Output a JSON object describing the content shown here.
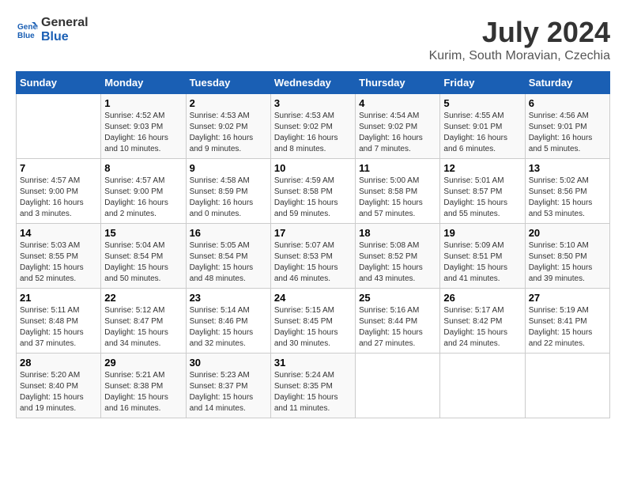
{
  "header": {
    "logo_line1": "General",
    "logo_line2": "Blue",
    "month": "July 2024",
    "location": "Kurim, South Moravian, Czechia"
  },
  "weekdays": [
    "Sunday",
    "Monday",
    "Tuesday",
    "Wednesday",
    "Thursday",
    "Friday",
    "Saturday"
  ],
  "weeks": [
    [
      {
        "day": "",
        "info": ""
      },
      {
        "day": "1",
        "info": "Sunrise: 4:52 AM\nSunset: 9:03 PM\nDaylight: 16 hours\nand 10 minutes."
      },
      {
        "day": "2",
        "info": "Sunrise: 4:53 AM\nSunset: 9:02 PM\nDaylight: 16 hours\nand 9 minutes."
      },
      {
        "day": "3",
        "info": "Sunrise: 4:53 AM\nSunset: 9:02 PM\nDaylight: 16 hours\nand 8 minutes."
      },
      {
        "day": "4",
        "info": "Sunrise: 4:54 AM\nSunset: 9:02 PM\nDaylight: 16 hours\nand 7 minutes."
      },
      {
        "day": "5",
        "info": "Sunrise: 4:55 AM\nSunset: 9:01 PM\nDaylight: 16 hours\nand 6 minutes."
      },
      {
        "day": "6",
        "info": "Sunrise: 4:56 AM\nSunset: 9:01 PM\nDaylight: 16 hours\nand 5 minutes."
      }
    ],
    [
      {
        "day": "7",
        "info": "Sunrise: 4:57 AM\nSunset: 9:00 PM\nDaylight: 16 hours\nand 3 minutes."
      },
      {
        "day": "8",
        "info": "Sunrise: 4:57 AM\nSunset: 9:00 PM\nDaylight: 16 hours\nand 2 minutes."
      },
      {
        "day": "9",
        "info": "Sunrise: 4:58 AM\nSunset: 8:59 PM\nDaylight: 16 hours\nand 0 minutes."
      },
      {
        "day": "10",
        "info": "Sunrise: 4:59 AM\nSunset: 8:58 PM\nDaylight: 15 hours\nand 59 minutes."
      },
      {
        "day": "11",
        "info": "Sunrise: 5:00 AM\nSunset: 8:58 PM\nDaylight: 15 hours\nand 57 minutes."
      },
      {
        "day": "12",
        "info": "Sunrise: 5:01 AM\nSunset: 8:57 PM\nDaylight: 15 hours\nand 55 minutes."
      },
      {
        "day": "13",
        "info": "Sunrise: 5:02 AM\nSunset: 8:56 PM\nDaylight: 15 hours\nand 53 minutes."
      }
    ],
    [
      {
        "day": "14",
        "info": "Sunrise: 5:03 AM\nSunset: 8:55 PM\nDaylight: 15 hours\nand 52 minutes."
      },
      {
        "day": "15",
        "info": "Sunrise: 5:04 AM\nSunset: 8:54 PM\nDaylight: 15 hours\nand 50 minutes."
      },
      {
        "day": "16",
        "info": "Sunrise: 5:05 AM\nSunset: 8:54 PM\nDaylight: 15 hours\nand 48 minutes."
      },
      {
        "day": "17",
        "info": "Sunrise: 5:07 AM\nSunset: 8:53 PM\nDaylight: 15 hours\nand 46 minutes."
      },
      {
        "day": "18",
        "info": "Sunrise: 5:08 AM\nSunset: 8:52 PM\nDaylight: 15 hours\nand 43 minutes."
      },
      {
        "day": "19",
        "info": "Sunrise: 5:09 AM\nSunset: 8:51 PM\nDaylight: 15 hours\nand 41 minutes."
      },
      {
        "day": "20",
        "info": "Sunrise: 5:10 AM\nSunset: 8:50 PM\nDaylight: 15 hours\nand 39 minutes."
      }
    ],
    [
      {
        "day": "21",
        "info": "Sunrise: 5:11 AM\nSunset: 8:48 PM\nDaylight: 15 hours\nand 37 minutes."
      },
      {
        "day": "22",
        "info": "Sunrise: 5:12 AM\nSunset: 8:47 PM\nDaylight: 15 hours\nand 34 minutes."
      },
      {
        "day": "23",
        "info": "Sunrise: 5:14 AM\nSunset: 8:46 PM\nDaylight: 15 hours\nand 32 minutes."
      },
      {
        "day": "24",
        "info": "Sunrise: 5:15 AM\nSunset: 8:45 PM\nDaylight: 15 hours\nand 30 minutes."
      },
      {
        "day": "25",
        "info": "Sunrise: 5:16 AM\nSunset: 8:44 PM\nDaylight: 15 hours\nand 27 minutes."
      },
      {
        "day": "26",
        "info": "Sunrise: 5:17 AM\nSunset: 8:42 PM\nDaylight: 15 hours\nand 24 minutes."
      },
      {
        "day": "27",
        "info": "Sunrise: 5:19 AM\nSunset: 8:41 PM\nDaylight: 15 hours\nand 22 minutes."
      }
    ],
    [
      {
        "day": "28",
        "info": "Sunrise: 5:20 AM\nSunset: 8:40 PM\nDaylight: 15 hours\nand 19 minutes."
      },
      {
        "day": "29",
        "info": "Sunrise: 5:21 AM\nSunset: 8:38 PM\nDaylight: 15 hours\nand 16 minutes."
      },
      {
        "day": "30",
        "info": "Sunrise: 5:23 AM\nSunset: 8:37 PM\nDaylight: 15 hours\nand 14 minutes."
      },
      {
        "day": "31",
        "info": "Sunrise: 5:24 AM\nSunset: 8:35 PM\nDaylight: 15 hours\nand 11 minutes."
      },
      {
        "day": "",
        "info": ""
      },
      {
        "day": "",
        "info": ""
      },
      {
        "day": "",
        "info": ""
      }
    ]
  ]
}
